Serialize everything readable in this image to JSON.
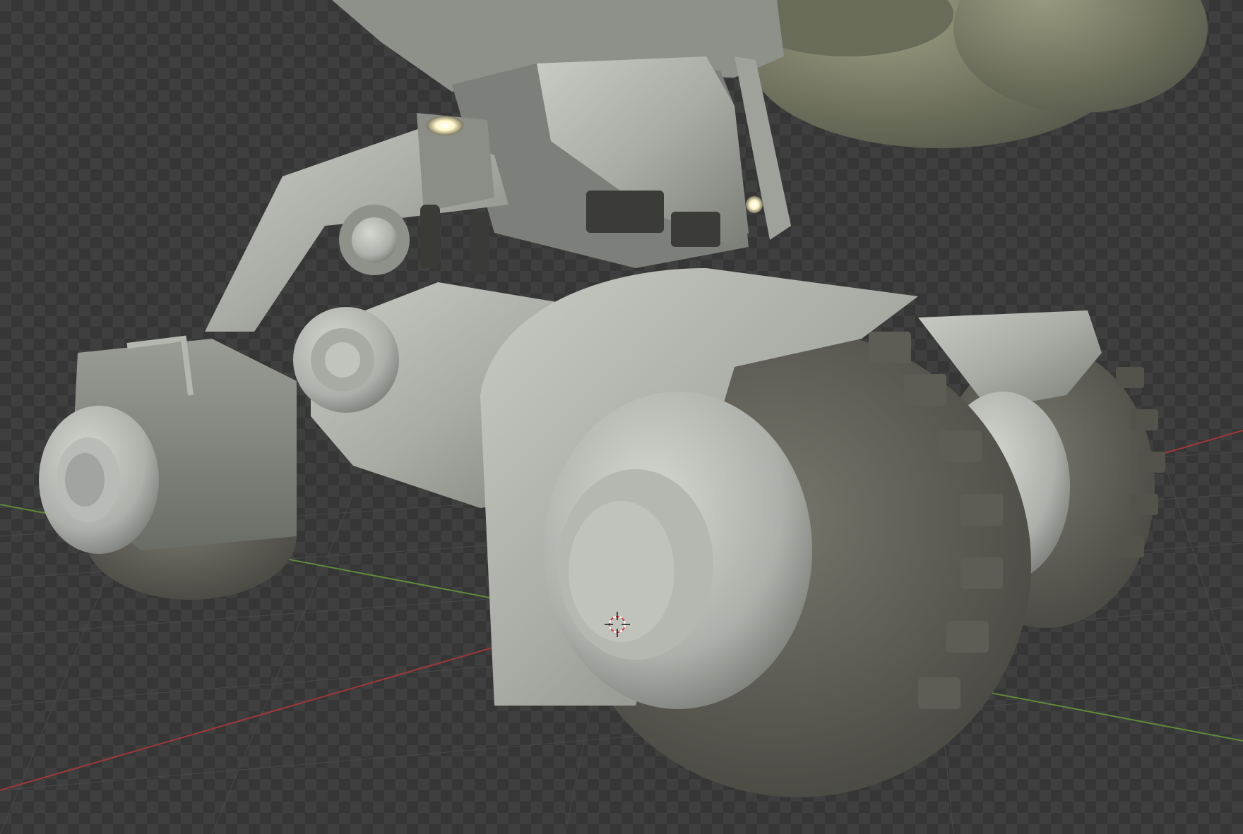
{
  "viewport": {
    "kind": "3d-viewport",
    "background_color": "#3f3f3f",
    "checker_color": "#363636",
    "x_axis_color": "#a03838",
    "y_axis_color": "#5f8a3a",
    "grid_color": "#4b4b4b",
    "model_base_color": "#a8aaa4",
    "tire_color": "#5a5a52",
    "light_color": "#fff6c8"
  },
  "icons": {
    "cursor": "3d-cursor-icon"
  }
}
